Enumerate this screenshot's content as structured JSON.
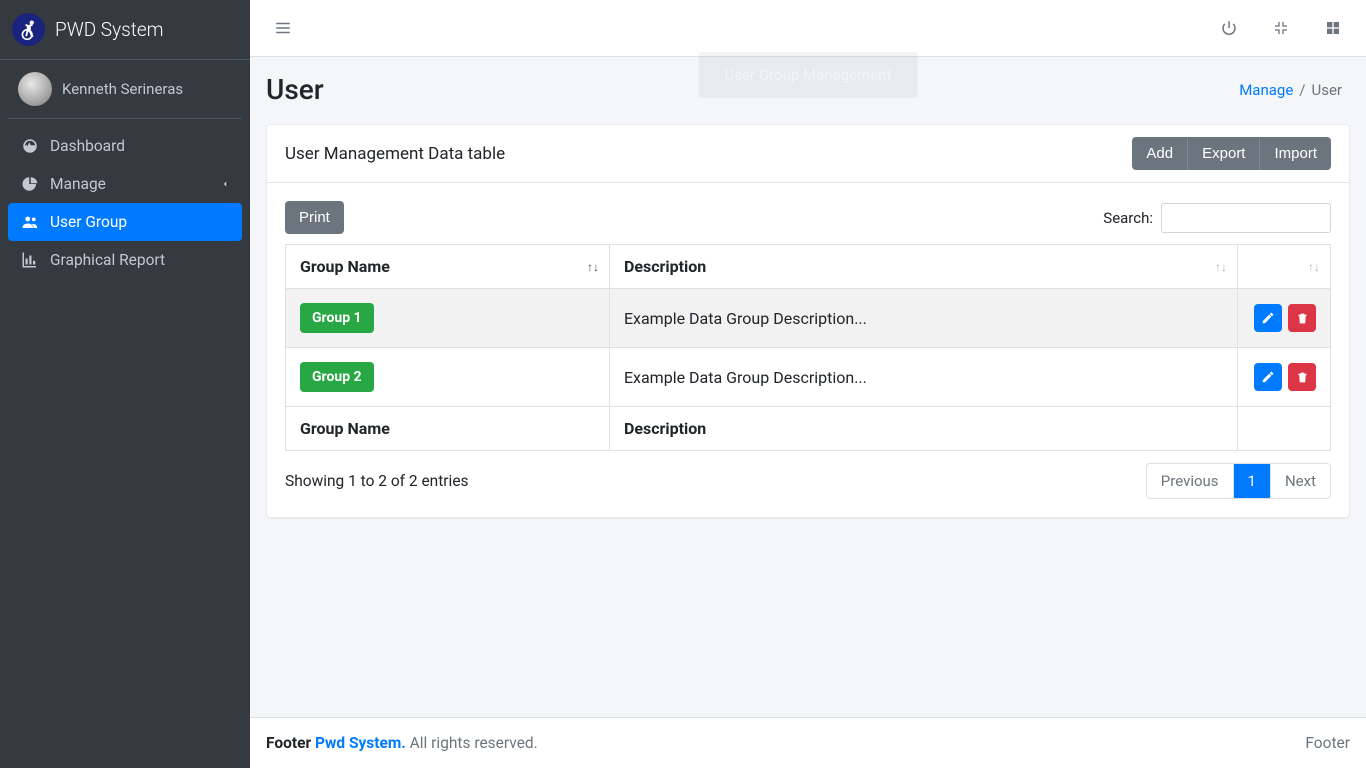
{
  "brand": {
    "name": "PWD System"
  },
  "user": {
    "name": "Kenneth Serineras"
  },
  "sidebar": {
    "items": [
      {
        "label": "Dashboard"
      },
      {
        "label": "Manage"
      },
      {
        "label": "User Group"
      },
      {
        "label": "Graphical Report"
      }
    ]
  },
  "toast": {
    "text": "User Group Management"
  },
  "page": {
    "title": "User",
    "breadcrumb": {
      "parent": "Manage",
      "sep": "/",
      "current": "User"
    }
  },
  "card": {
    "title": "User Management Data table",
    "buttons": {
      "add": "Add",
      "export": "Export",
      "import": "Import",
      "print": "Print"
    }
  },
  "table": {
    "search_label": "Search:",
    "columns": {
      "group_name": "Group Name",
      "description": "Description"
    },
    "rows": [
      {
        "name": "Group 1",
        "description": "Example Data Group Description..."
      },
      {
        "name": "Group 2",
        "description": "Example Data Group Description..."
      }
    ],
    "footer_cols": {
      "group_name": "Group Name",
      "description": "Description"
    },
    "info": "Showing 1 to 2 of 2 entries",
    "pagination": {
      "prev": "Previous",
      "page1": "1",
      "next": "Next"
    }
  },
  "footer": {
    "left_prefix": "Footer ",
    "brand": "Pwd System.",
    "rights": " All rights reserved.",
    "right": "Footer"
  }
}
